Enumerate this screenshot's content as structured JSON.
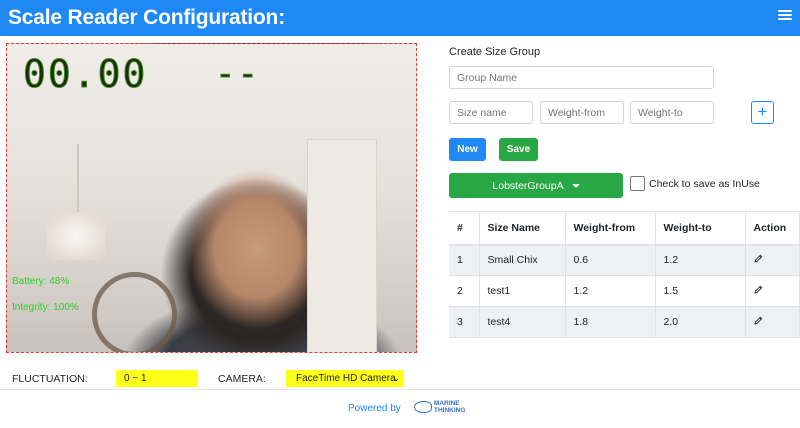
{
  "header": {
    "title": "Scale Reader Configuration:",
    "menu_icon": "hamburger-menu-icon"
  },
  "camera_view": {
    "weight_display": "00.00",
    "status_display": "--",
    "battery": "Battery: 48%",
    "integrity": "Integrity: 100%"
  },
  "controls": {
    "fluctuation_label": "FLUCTUATION:",
    "fluctuation_value": "0 ~ 1",
    "camera_label": "CAMERA:",
    "camera_value": "FaceTime HD Camera"
  },
  "size_group": {
    "title": "Create Size Group",
    "group_name_placeholder": "Group Name",
    "size_name_placeholder": "Size name",
    "weight_from_placeholder": "Weight-from",
    "weight_to_placeholder": "Weight-to",
    "plus_label": "+",
    "new_label": "New",
    "save_label": "Save",
    "selected_group": "LobsterGroupA",
    "inuse_label": "Check to save as InUse"
  },
  "table": {
    "headers": [
      "#",
      "Size Name",
      "Weight-from",
      "Weight-to",
      "Action"
    ],
    "rows": [
      {
        "num": "1",
        "name": "Small Chix",
        "from": "0.6",
        "to": "1.2"
      },
      {
        "num": "2",
        "name": "test1",
        "from": "1.2",
        "to": "1.5"
      },
      {
        "num": "3",
        "name": "test4",
        "from": "1.8",
        "to": "2.0"
      }
    ]
  },
  "footer": {
    "powered_by": "Powered by",
    "logo_line1": "MARINE",
    "logo_line2": "THINKING"
  },
  "colors": {
    "header": "#1e88f5",
    "primary": "#1e88f5",
    "success": "#28a745",
    "highlight": "#ffff1a",
    "overlay_text": "#2cd12c"
  }
}
